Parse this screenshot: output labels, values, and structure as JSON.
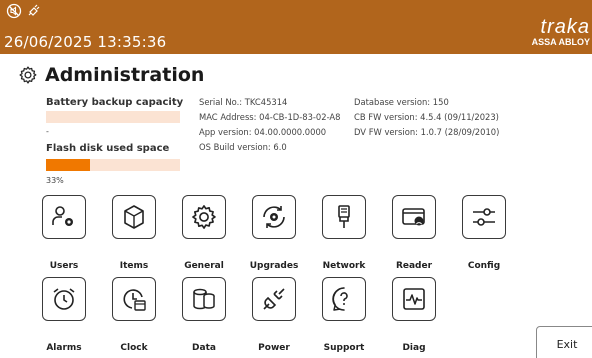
{
  "header": {
    "datetime": "26/06/2025 13:35:36",
    "status_icons": [
      "no-speaker-icon",
      "unplugged-icon"
    ],
    "brand_name": "traka",
    "brand_sub": "ASSA ABLOY",
    "bg_color": "#b1651c"
  },
  "title": "Administration",
  "battery": {
    "label": "Battery backup capacity",
    "value_text": "-",
    "percent": 0
  },
  "flash": {
    "label": "Flash disk used space",
    "value_text": "33%",
    "percent": 33,
    "fill_color": "#f07800"
  },
  "system_info": {
    "col1": [
      "Serial No.: TKC45314",
      "MAC Address: 04-CB-1D-83-02-A8",
      "App version: 04.00.0000.0000",
      "OS Build version: 6.0"
    ],
    "col2": [
      "Database version: 150",
      "CB FW version: 4.5.4 (09/11/2023)",
      "DV FW version: 1.0.7 (28/09/2010)"
    ]
  },
  "tiles_row1": [
    {
      "label": "Users",
      "icon": "users-gear-icon"
    },
    {
      "label": "Items",
      "icon": "item-box-icon"
    },
    {
      "label": "General",
      "icon": "gear-icon"
    },
    {
      "label": "Upgrades",
      "icon": "refresh-gear-icon"
    },
    {
      "label": "Network",
      "icon": "network-plug-icon"
    },
    {
      "label": "Reader",
      "icon": "card-reader-icon"
    },
    {
      "label": "Config",
      "icon": "sliders-icon"
    }
  ],
  "tiles_row2": [
    {
      "label": "Alarms",
      "icon": "alarm-clock-icon"
    },
    {
      "label": "Clock",
      "icon": "clock-calendar-icon"
    },
    {
      "label": "Data",
      "icon": "database-icon"
    },
    {
      "label": "Power",
      "icon": "power-plug-icon"
    },
    {
      "label": "Support",
      "icon": "help-bubble-icon"
    },
    {
      "label": "Diag",
      "icon": "diagnostics-icon"
    }
  ],
  "exit_label": "Exit"
}
